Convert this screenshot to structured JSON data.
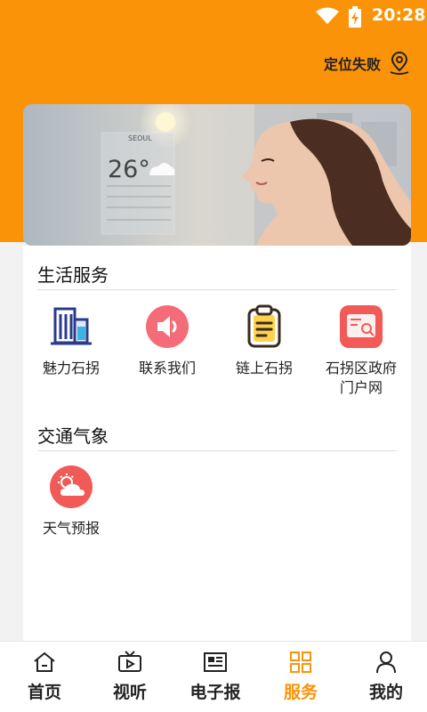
{
  "status_bar": {
    "time": "20:28"
  },
  "header": {
    "location_text": "定位失败"
  },
  "banner": {
    "image": "woman-with-weather-hologram",
    "weather_city": "SEOUL",
    "weather_temp": "26°"
  },
  "life_services": {
    "title": "生活服务",
    "items": [
      {
        "label": "魅力石拐",
        "icon": "city-buildings-icon"
      },
      {
        "label": "联系我们",
        "icon": "speaker-icon"
      },
      {
        "label": "链上石拐",
        "icon": "clipboard-icon"
      },
      {
        "label": "石拐区政府门户网",
        "icon": "web-portal-icon"
      }
    ]
  },
  "traffic_weather": {
    "title": "交通气象",
    "items": [
      {
        "label": "天气预报",
        "icon": "weather-icon"
      }
    ]
  },
  "bottom_nav": {
    "active_color": "#fb9308",
    "items": [
      {
        "label": "首页",
        "icon": "home-icon"
      },
      {
        "label": "视听",
        "icon": "tv-icon"
      },
      {
        "label": "电子报",
        "icon": "newspaper-icon"
      },
      {
        "label": "服务",
        "icon": "grid-icon",
        "active": true
      },
      {
        "label": "我的",
        "icon": "user-icon"
      }
    ]
  },
  "colors": {
    "accent": "#fb9308",
    "icon_red": "#f15a56"
  }
}
